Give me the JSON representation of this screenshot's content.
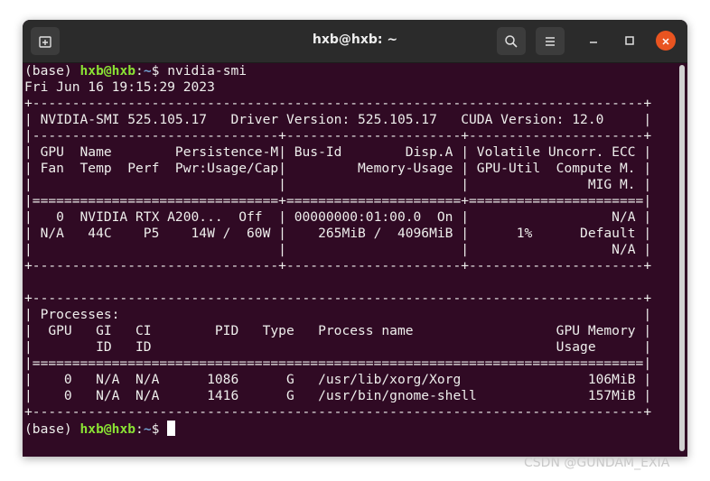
{
  "window": {
    "title": "hxb@hxb: ~"
  },
  "terminal": {
    "env_prefix": "(base) ",
    "user_host": "hxb@hxb",
    "path_sep": ":",
    "cwd": "~",
    "prompt_symbol": "$ ",
    "command": "nvidia-smi",
    "date_line": "Fri Jun 16 19:15:29 2023",
    "output_lines": [
      "+-----------------------------------------------------------------------------+",
      "| NVIDIA-SMI 525.105.17   Driver Version: 525.105.17   CUDA Version: 12.0     |",
      "|-------------------------------+----------------------+----------------------+",
      "| GPU  Name        Persistence-M| Bus-Id        Disp.A | Volatile Uncorr. ECC |",
      "| Fan  Temp  Perf  Pwr:Usage/Cap|         Memory-Usage | GPU-Util  Compute M. |",
      "|                               |                      |               MIG M. |",
      "|===============================+======================+======================|",
      "|   0  NVIDIA RTX A200...  Off  | 00000000:01:00.0  On |                  N/A |",
      "| N/A   44C    P5    14W /  60W |    265MiB /  4096MiB |      1%      Default |",
      "|                               |                      |                  N/A |",
      "+-------------------------------+----------------------+----------------------+",
      "",
      "+-----------------------------------------------------------------------------+",
      "| Processes:                                                                  |",
      "|  GPU   GI   CI        PID   Type   Process name                  GPU Memory |",
      "|        ID   ID                                                   Usage      |",
      "|=============================================================================|",
      "|    0   N/A  N/A      1086      G   /usr/lib/xorg/Xorg                106MiB |",
      "|    0   N/A  N/A      1416      G   /usr/bin/gnome-shell              157MiB |",
      "+-----------------------------------------------------------------------------+"
    ]
  },
  "icons": {
    "new_tab": "new-tab-icon",
    "search": "search-icon",
    "menu": "hamburger-menu-icon",
    "minimize": "minimize-icon",
    "maximize": "maximize-icon",
    "close": "close-icon"
  },
  "colors": {
    "terminal_bg": "#300a24",
    "titlebar_bg": "#2b2b2b",
    "prompt_user": "#8ae234",
    "prompt_path": "#729fcf",
    "close_button": "#e95420"
  },
  "watermark": "CSDN @GUNDAM_EXIA"
}
